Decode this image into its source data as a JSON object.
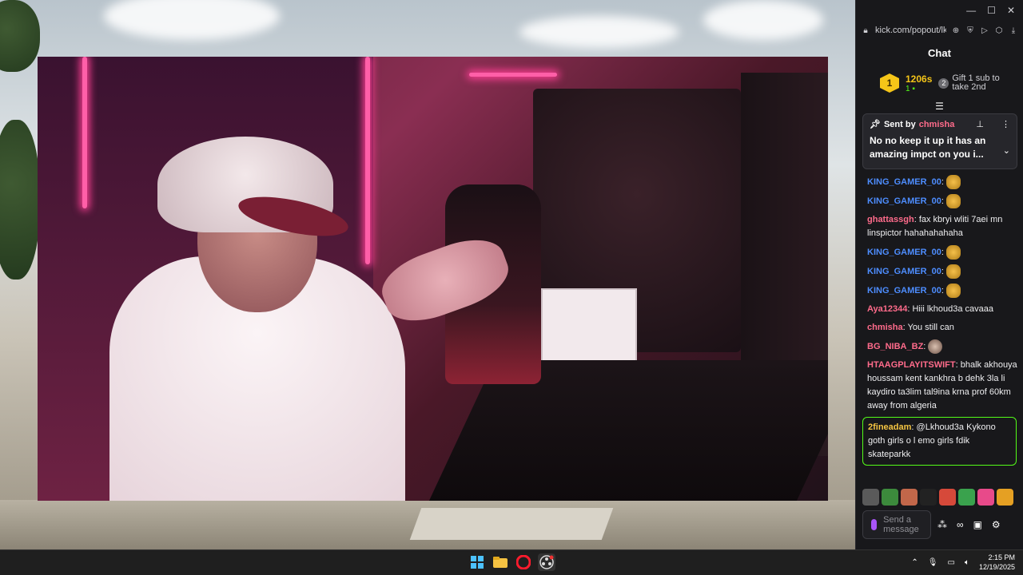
{
  "browser": {
    "url": "kick.com/popout/lk",
    "window_controls": [
      "minimize-icon",
      "maximize-icon",
      "close-icon"
    ]
  },
  "chat": {
    "title": "Chat",
    "leaderboard": {
      "rank": "1",
      "value": "1206s",
      "sub_count": "1",
      "gift_rank": "2",
      "gift_text": "Gift 1 sub to take 2nd"
    },
    "pinned": {
      "sent_by_label": "Sent by",
      "sender": "chmisha",
      "message": "No no keep it up it has an amazing impct on you i..."
    },
    "messages": [
      {
        "user": "KING_GAMER_00",
        "color": "#4d8dff",
        "text": "",
        "emote": "pray"
      },
      {
        "user": "KING_GAMER_00",
        "color": "#4d8dff",
        "text": "",
        "emote": "pray"
      },
      {
        "user": "ghattassgh",
        "color": "#ff6b8b",
        "text": "fax kbryi wliti 7aei mn linspictor hahahahahaha",
        "emote": ""
      },
      {
        "user": "KING_GAMER_00",
        "color": "#4d8dff",
        "text": "",
        "emote": "pray"
      },
      {
        "user": "KING_GAMER_00",
        "color": "#4d8dff",
        "text": "",
        "emote": "pray"
      },
      {
        "user": "KING_GAMER_00",
        "color": "#4d8dff",
        "text": "",
        "emote": "pray"
      },
      {
        "user": "Aya12344",
        "color": "#ff6b8b",
        "text": "Hiii lkhoud3a cavaaa",
        "emote": ""
      },
      {
        "user": "chmisha",
        "color": "#ff6b8b",
        "text": "You still can",
        "emote": ""
      },
      {
        "user": "BG_NIBA_BZ",
        "color": "#ff6b8b",
        "text": "",
        "emote": "face"
      },
      {
        "user": "HTAAGPLAYITSWIFT",
        "color": "#ff6b8b",
        "text": "bhalk akhouya houssam kent kankhra b dehk 3la li kaydiro ta3lim tal9ina krna prof 60km away from algeria",
        "emote": ""
      }
    ],
    "highlighted": {
      "user": "2fineadam",
      "color": "#f5c542",
      "text": "@Lkhoud3a Kykono goth girls o l emo girls fdik skateparkk"
    },
    "emote_bar_colors": [
      "#5a5a5a",
      "#3c8a3c",
      "#c2674a",
      "#222222",
      "#d6493a",
      "#3aa24d",
      "#e84a8a",
      "#e5a023"
    ],
    "input_placeholder": "Send a message"
  },
  "taskbar": {
    "time": "2:15 PM",
    "date": "12/19/2025"
  }
}
